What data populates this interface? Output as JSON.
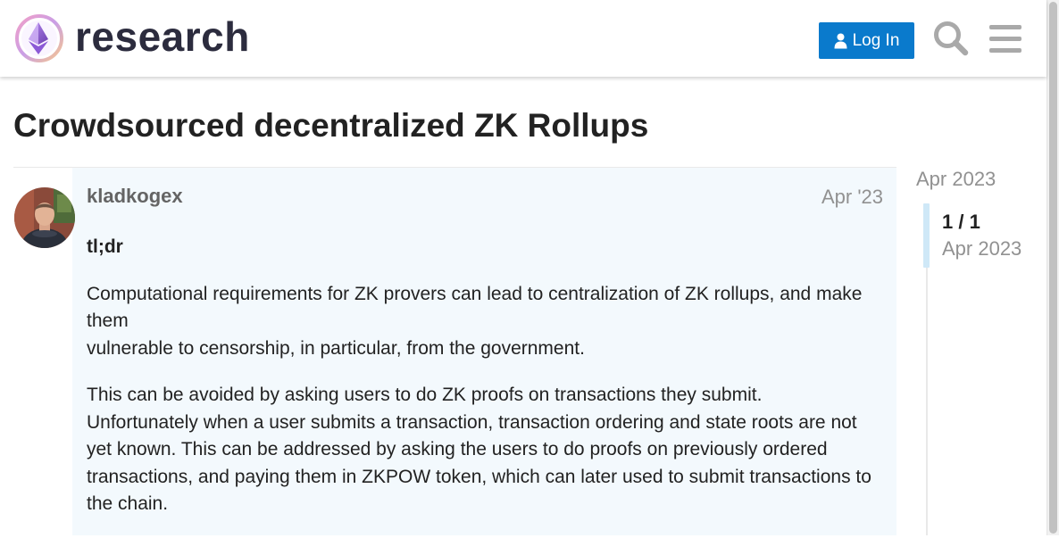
{
  "header": {
    "logo_text": "research",
    "login_label": "Log In",
    "search_icon": "search-icon",
    "menu_icon": "hamburger-menu-icon",
    "accent_color": "#0a7acc"
  },
  "topic": {
    "title": "Crowdsourced decentralized ZK Rollups"
  },
  "post": {
    "username": "kladkogex",
    "date": "Apr '23",
    "tldr": "tl;dr",
    "para1_line1": "Computational requirements for ZK provers can lead to centralization of ZK rollups, and make them",
    "para1_line2": "vulnerable to censorship, in particular, from the government.",
    "para2": "This can be avoided by asking users to do ZK proofs on transactions they submit. Unfortunately when a user submits a transaction, transaction ordering and state roots are not yet known. This can be addressed by asking the users to do proofs on previously ordered transactions, and paying them in ZKPOW token, which can later used to submit transactions to the chain."
  },
  "timeline": {
    "start_date": "Apr 2023",
    "position": "1 / 1",
    "current_date": "Apr 2023"
  }
}
